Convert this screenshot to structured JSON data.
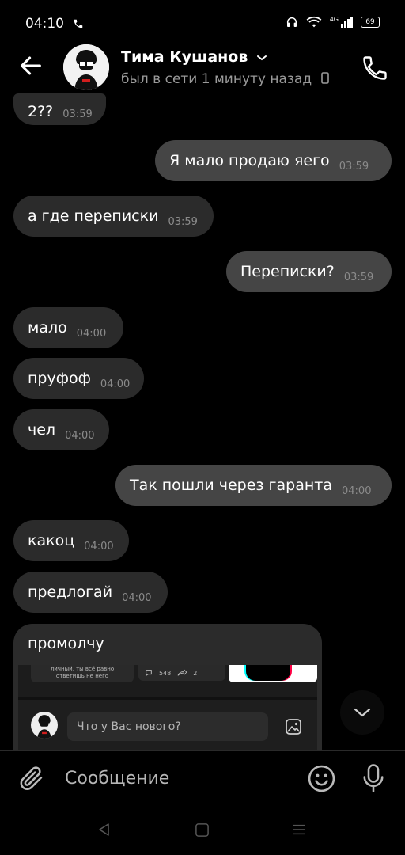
{
  "status_bar": {
    "time": "04:10",
    "network": "4G",
    "battery": "69"
  },
  "header": {
    "contact_name": "Тима Кушанов",
    "contact_status": "был в сети 1 минуту назад"
  },
  "messages": [
    {
      "text": "2??",
      "time": "03:59",
      "dir": "in"
    },
    {
      "text": "Я мало продаю яего",
      "time": "03:59",
      "dir": "out"
    },
    {
      "text": "а где переписки",
      "time": "03:59",
      "dir": "in"
    },
    {
      "text": "Переписки?",
      "time": "03:59",
      "dir": "out"
    },
    {
      "text": "мало",
      "time": "04:00",
      "dir": "in"
    },
    {
      "text": "пруфоф",
      "time": "04:00",
      "dir": "in"
    },
    {
      "text": "чел",
      "time": "04:00",
      "dir": "in"
    },
    {
      "text": "Так пошли через гаранта",
      "time": "04:00",
      "dir": "out"
    },
    {
      "text": "какоц",
      "time": "04:00",
      "dir": "in"
    },
    {
      "text": "предлогай",
      "time": "04:00",
      "dir": "in"
    },
    {
      "text": "промолчу",
      "time": "",
      "dir": "in"
    }
  ],
  "embedded_screenshot": {
    "post_text_line1": "личный, ты всё равно",
    "post_text_line2": "ответишь не него",
    "comments_count": "548",
    "shares_count": "2",
    "new_post_placeholder": "Что у Вас нового?"
  },
  "composer": {
    "placeholder": "Сообщение"
  },
  "icons": {
    "back": "arrow-left-icon",
    "call": "phone-icon",
    "scroll_down": "chevron-down-icon",
    "attach": "paperclip-icon",
    "emoji": "smiley-icon",
    "voice": "microphone-icon"
  },
  "colors": {
    "background": "#000000",
    "incoming_bubble": "#2b2b2b",
    "outgoing_bubble": "#454545",
    "secondary_text": "#9a9a9a"
  }
}
